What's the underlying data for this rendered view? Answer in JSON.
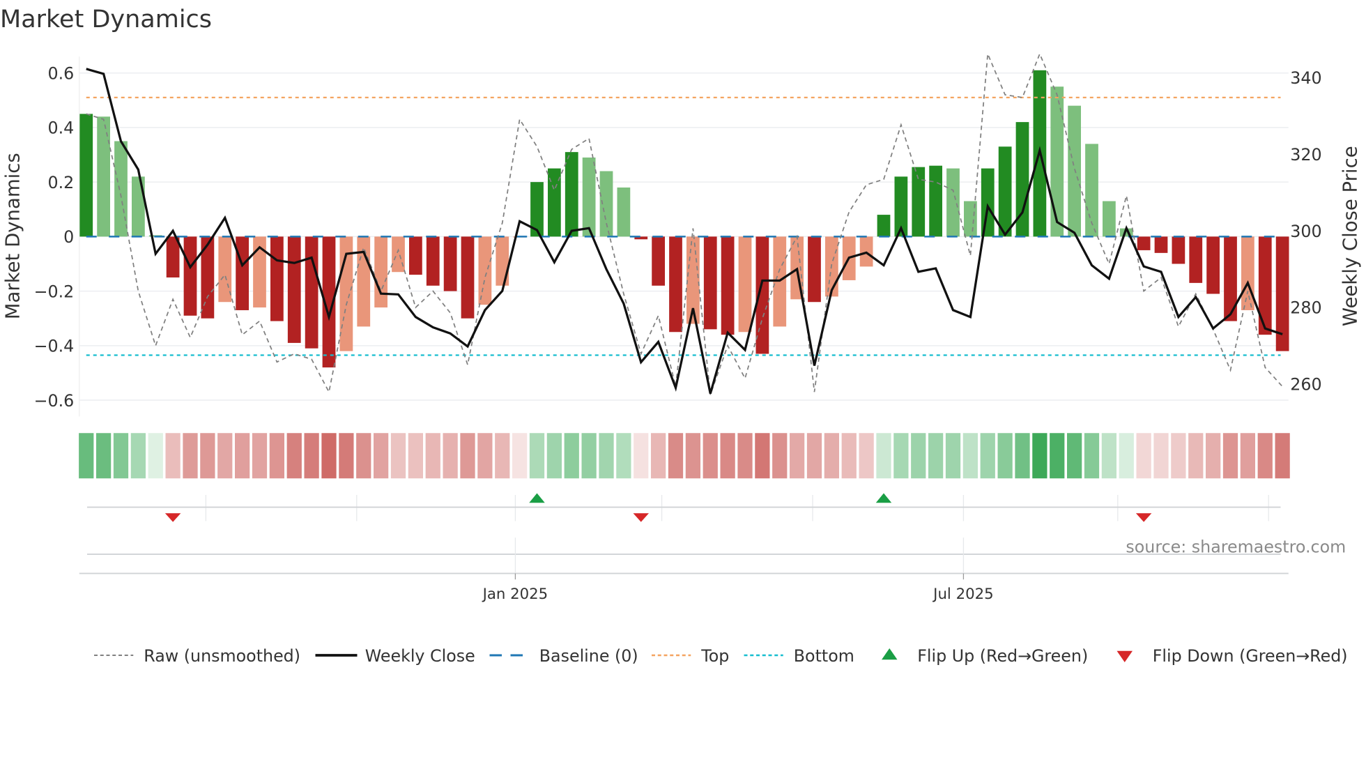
{
  "chart_data": {
    "type": "bar",
    "title": "Market Dynamics",
    "ylabel": "Market Dynamics",
    "y2label": "Weekly Close Price",
    "ylim": [
      -0.66,
      0.66
    ],
    "y2lim": [
      251.5,
      345.5
    ],
    "yticks": [
      0.6,
      0.4,
      0.2,
      0,
      -0.2,
      -0.4,
      -0.6
    ],
    "ytick_labels": [
      "0.6",
      "0.4",
      "0.2",
      "0",
      "−0.2",
      "−0.4",
      "−0.6"
    ],
    "y2ticks": [
      340,
      320,
      300,
      280,
      260
    ],
    "y2tick_labels": [
      "340",
      "320",
      "300",
      "280",
      "260"
    ],
    "xtick_labels": [
      {
        "label": "Jan 2025",
        "index": 24.75
      },
      {
        "label": "Jul 2025",
        "index": 50.6
      }
    ],
    "month_grid_index": [
      6.9,
      15.6,
      24.75,
      33.2,
      41.9,
      50.6,
      59.5,
      68.2
    ],
    "top_level": 0.51,
    "bottom_level": -0.435,
    "baseline": 0,
    "values": [
      0.45,
      0.44,
      0.35,
      0.22,
      0.005,
      -0.15,
      -0.29,
      -0.3,
      -0.24,
      -0.27,
      -0.26,
      -0.31,
      -0.39,
      -0.41,
      -0.48,
      -0.42,
      -0.33,
      -0.26,
      -0.13,
      -0.14,
      -0.18,
      -0.2,
      -0.3,
      -0.25,
      -0.18,
      -0.003,
      0.2,
      0.25,
      0.31,
      0.29,
      0.24,
      0.18,
      -0.01,
      -0.18,
      -0.35,
      -0.32,
      -0.34,
      -0.36,
      -0.35,
      -0.43,
      -0.33,
      -0.23,
      -0.24,
      -0.22,
      -0.16,
      -0.11,
      0.08,
      0.22,
      0.255,
      0.26,
      0.25,
      0.13,
      0.25,
      0.33,
      0.42,
      0.61,
      0.55,
      0.48,
      0.34,
      0.13,
      0.03,
      -0.05,
      -0.06,
      -0.1,
      -0.17,
      -0.21,
      -0.31,
      -0.27,
      -0.36,
      -0.42
    ],
    "strength": [
      "strong",
      "weak",
      "weak",
      "weak",
      "weak",
      "strong",
      "strong",
      "strong",
      "weak",
      "strong",
      "weak",
      "strong",
      "strong",
      "strong",
      "strong",
      "weak",
      "weak",
      "weak",
      "weak",
      "strong",
      "strong",
      "strong",
      "strong",
      "weak",
      "weak",
      "weak",
      "strong",
      "strong",
      "strong",
      "weak",
      "weak",
      "weak",
      "strong",
      "strong",
      "strong",
      "weak",
      "strong",
      "strong",
      "weak",
      "strong",
      "weak",
      "weak",
      "strong",
      "weak",
      "weak",
      "weak",
      "strong",
      "strong",
      "strong",
      "strong",
      "weak",
      "weak",
      "strong",
      "strong",
      "strong",
      "strong",
      "weak",
      "weak",
      "weak",
      "weak",
      "weak",
      "strong",
      "strong",
      "strong",
      "strong",
      "strong",
      "strong",
      "weak",
      "strong",
      "strong"
    ],
    "raw": [
      0.45,
      0.43,
      0.15,
      -0.2,
      -0.4,
      -0.23,
      -0.37,
      -0.22,
      -0.14,
      -0.36,
      -0.31,
      -0.46,
      -0.43,
      -0.45,
      -0.57,
      -0.25,
      -0.04,
      -0.2,
      -0.05,
      -0.26,
      -0.2,
      -0.28,
      -0.47,
      -0.15,
      0.05,
      0.43,
      0.33,
      0.17,
      0.32,
      0.36,
      0.05,
      -0.21,
      -0.43,
      -0.29,
      -0.55,
      0.03,
      -0.58,
      -0.4,
      -0.52,
      -0.3,
      -0.12,
      0.0,
      -0.57,
      -0.1,
      0.09,
      0.19,
      0.21,
      0.41,
      0.21,
      0.2,
      0.17,
      -0.07,
      0.67,
      0.52,
      0.51,
      0.67,
      0.52,
      0.25,
      0.05,
      -0.1,
      0.15,
      -0.2,
      -0.15,
      -0.33,
      -0.21,
      -0.34,
      -0.49,
      -0.2,
      -0.48,
      -0.55
    ],
    "weekly_close": [
      342.3,
      341,
      323.4,
      316,
      294,
      300,
      290.5,
      296.4,
      303.4,
      291,
      295.7,
      292.3,
      291.6,
      293,
      277.5,
      294,
      294.5,
      283.6,
      283.4,
      277.5,
      274.8,
      273.2,
      269.8,
      279.3,
      284.3,
      302.5,
      300.2,
      291.8,
      300,
      300.7,
      290,
      281,
      265.7,
      271,
      259,
      279.8,
      257.5,
      273.4,
      268.9,
      287,
      287,
      290,
      264.8,
      284.5,
      293,
      294.3,
      291,
      300.7,
      289.3,
      290.2,
      279.3,
      277.5,
      306.4,
      299,
      304.8,
      321,
      302.3,
      299.5,
      291,
      287.5,
      300.7,
      290.7,
      289.3,
      277.5,
      282.7,
      274.5,
      278.2,
      286.4,
      274.5,
      273
    ],
    "flips": [
      {
        "index": 5,
        "direction": "down"
      },
      {
        "index": 26,
        "direction": "up"
      },
      {
        "index": 32,
        "direction": "down"
      },
      {
        "index": 46,
        "direction": "up"
      },
      {
        "index": 61,
        "direction": "down"
      }
    ],
    "legend": {
      "placement": "bottom",
      "entries": [
        "Raw (unsmoothed)",
        "Weekly Close",
        "Baseline (0)",
        "Top",
        "Bottom",
        "Flip Up (Red→Green)",
        "Flip Down (Green→Red)"
      ]
    },
    "source": "source: sharemaestro.com",
    "colors": {
      "strong_green": "#228b22",
      "weak_green": "#7dbf7d",
      "strong_red": "#b22222",
      "weak_red": "#e9967a",
      "raw": "#808080",
      "close": "#111111",
      "baseline": "#1f77b4",
      "top": "#f4a460",
      "bottom": "#17becf",
      "flip_up": "#1a9e45",
      "flip_down": "#d62728"
    }
  }
}
